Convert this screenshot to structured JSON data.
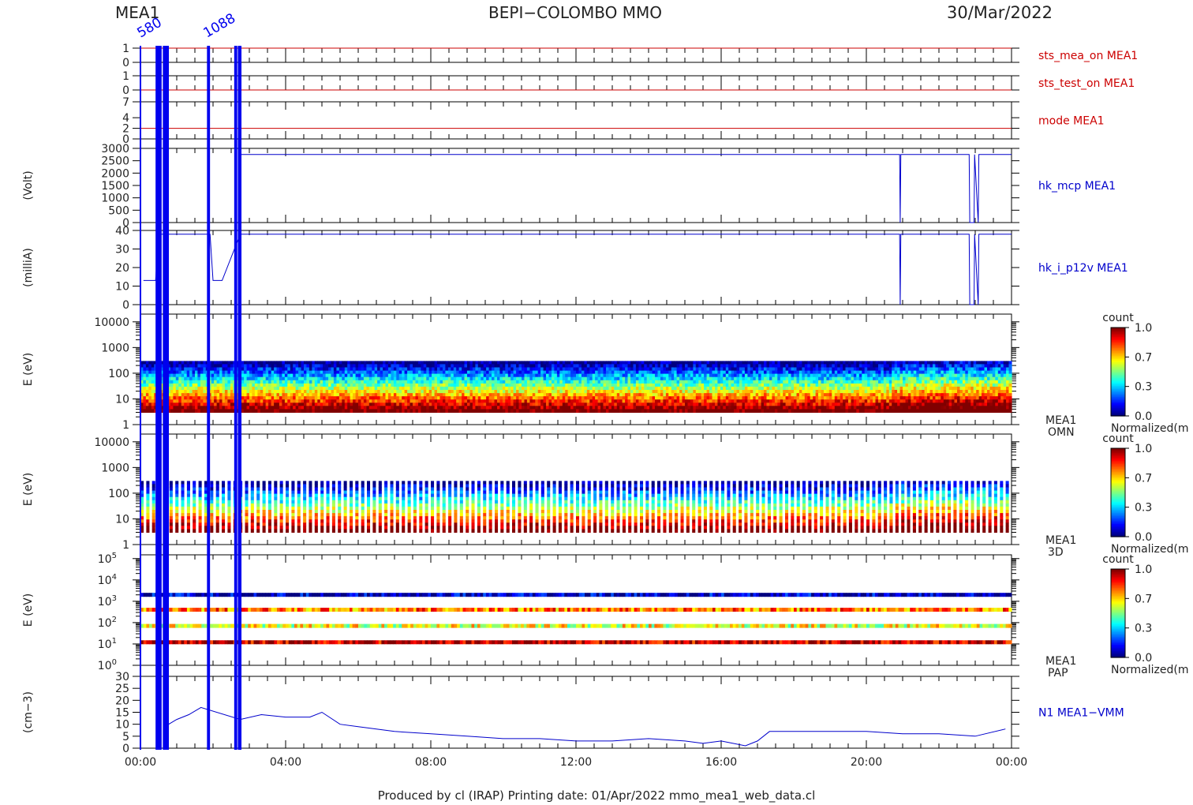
{
  "header": {
    "left": "MEA1",
    "center": "BEPI−COLOMBO MMO",
    "right": "30/Mar/2022",
    "overlay_labels": [
      "580",
      "1088"
    ]
  },
  "footer": {
    "text": "Produced by cl (IRAP)    Printing date: 01/Apr/2022    mmo_mea1_web_data.cl"
  },
  "colors": {
    "status": "#cc0000",
    "hk": "#0000cc",
    "gap_bars": "#0000ee",
    "axis": "#000000"
  },
  "chart_data": [
    {
      "type": "line",
      "id": "sts_mea_on",
      "label": "sts_mea_on MEA1",
      "yticks": [
        "1",
        "0"
      ],
      "ylim": [
        0,
        1
      ],
      "x": [
        "00:00",
        "24:00"
      ],
      "y": [
        1,
        1
      ]
    },
    {
      "type": "line",
      "id": "sts_test_on",
      "label": "sts_test_on MEA1",
      "yticks": [
        "1",
        "0"
      ],
      "ylim": [
        0,
        1
      ],
      "x": [
        "00:00",
        "24:00"
      ],
      "y": [
        0,
        0
      ]
    },
    {
      "type": "line",
      "id": "mode",
      "label": "mode MEA1",
      "yticks": [
        "7",
        "4",
        "2",
        "0"
      ],
      "ylim": [
        0,
        7
      ],
      "x": [
        "00:00",
        "24:00"
      ],
      "y": [
        2,
        2
      ]
    },
    {
      "type": "line",
      "id": "hk_mcp",
      "label": "hk_mcp MEA1",
      "ylabel": "(Volt)",
      "yticks": [
        "3000",
        "2500",
        "2000",
        "1500",
        "1000",
        "500",
        "0"
      ],
      "ylim": [
        0,
        3000
      ],
      "x": [
        "02:45",
        "20:55",
        "20:56",
        "20:57",
        "22:50",
        "22:51",
        "22:58",
        "22:59",
        "23:05",
        "23:06",
        "24:00"
      ],
      "y": [
        2750,
        2750,
        0,
        2750,
        2750,
        0,
        0,
        2750,
        0,
        2750,
        2750
      ]
    },
    {
      "type": "line",
      "id": "hk_i_p12v",
      "label": "hk_i_p12v MEA1",
      "ylabel": "(milliA)",
      "yticks": [
        "40",
        "30",
        "20",
        "10",
        "0"
      ],
      "ylim": [
        0,
        40
      ],
      "x": [
        "00:05",
        "00:25",
        "00:30",
        "01:55",
        "02:00",
        "02:15",
        "02:45",
        "20:55",
        "20:56",
        "20:57",
        "22:50",
        "22:51",
        "22:58",
        "22:59",
        "23:05",
        "23:06",
        "24:00"
      ],
      "y": [
        13,
        13,
        38,
        38,
        13,
        13,
        38,
        38,
        0,
        38,
        38,
        0,
        0,
        38,
        0,
        38,
        38
      ]
    },
    {
      "type": "heatmap",
      "id": "omni",
      "ylabel": "E (eV)",
      "side_label": [
        "MEA1",
        "OMN"
      ],
      "yticks": [
        "10000",
        "1000",
        "100",
        "10",
        "1"
      ],
      "yscale": "log",
      "ylim": [
        1,
        20000
      ],
      "energy_range": [
        3,
        300
      ],
      "colorbar": {
        "title": "count",
        "ticks": [
          "1.0",
          "0.7",
          "0.3",
          "0.0"
        ],
        "label": "Normalized(m"
      }
    },
    {
      "type": "heatmap",
      "id": "3d",
      "ylabel": "E (eV)",
      "side_label": [
        "MEA1",
        "3D"
      ],
      "yticks": [
        "10000",
        "1000",
        "100",
        "10",
        "1"
      ],
      "yscale": "log",
      "ylim": [
        1,
        20000
      ],
      "energy_range": [
        3,
        300
      ],
      "colorbar": {
        "title": "count",
        "ticks": [
          "1.0",
          "0.7",
          "0.3",
          "0.0"
        ],
        "label": "Normalized(m"
      }
    },
    {
      "type": "heatmap",
      "id": "pap",
      "ylabel": "E (eV)",
      "side_label": [
        "MEA1",
        "PAP"
      ],
      "yticks": [
        "10^5",
        "10^4",
        "10^3",
        "10^2",
        "10^1",
        "10^0"
      ],
      "yscale": "log",
      "ylim": [
        1,
        150000
      ],
      "bands_ev": [
        2000,
        400,
        70,
        12
      ],
      "colorbar": {
        "title": "count",
        "ticks": [
          "1.0",
          "0.7",
          "0.3",
          "0.0"
        ],
        "label": "Normalized(m"
      }
    },
    {
      "type": "line",
      "id": "density",
      "label": "N1 MEA1−VMM",
      "ylabel": "(cm−3)",
      "yticks": [
        "30",
        "25",
        "20",
        "15",
        "10",
        "5",
        "0"
      ],
      "ylim": [
        0,
        30
      ],
      "x": [
        "00:40",
        "01:00",
        "01:20",
        "01:40",
        "02:45",
        "03:20",
        "04:00",
        "04:40",
        "05:00",
        "05:30",
        "06:00",
        "07:00",
        "08:00",
        "09:00",
        "10:00",
        "11:00",
        "12:00",
        "13:00",
        "14:00",
        "15:00",
        "15:30",
        "16:00",
        "16:40",
        "17:00",
        "17:20",
        "18:00",
        "19:00",
        "20:00",
        "21:00",
        "22:00",
        "23:00",
        "23:50"
      ],
      "y": [
        9,
        12,
        14,
        17,
        12,
        14,
        13,
        13,
        15,
        10,
        9,
        7,
        6,
        5,
        4,
        4,
        3,
        3,
        4,
        3,
        2,
        3,
        1,
        3,
        7,
        7,
        7,
        7,
        6,
        6,
        5,
        8
      ]
    }
  ],
  "time_axis": {
    "ticks": [
      "00:00",
      "04:00",
      "08:00",
      "12:00",
      "16:00",
      "20:00",
      "00:00"
    ],
    "gaps": [
      [
        "00:25",
        "00:35"
      ],
      [
        "00:37",
        "00:47"
      ],
      [
        "01:50",
        "01:55"
      ],
      [
        "02:35",
        "02:40"
      ],
      [
        "02:41",
        "02:47"
      ]
    ]
  }
}
